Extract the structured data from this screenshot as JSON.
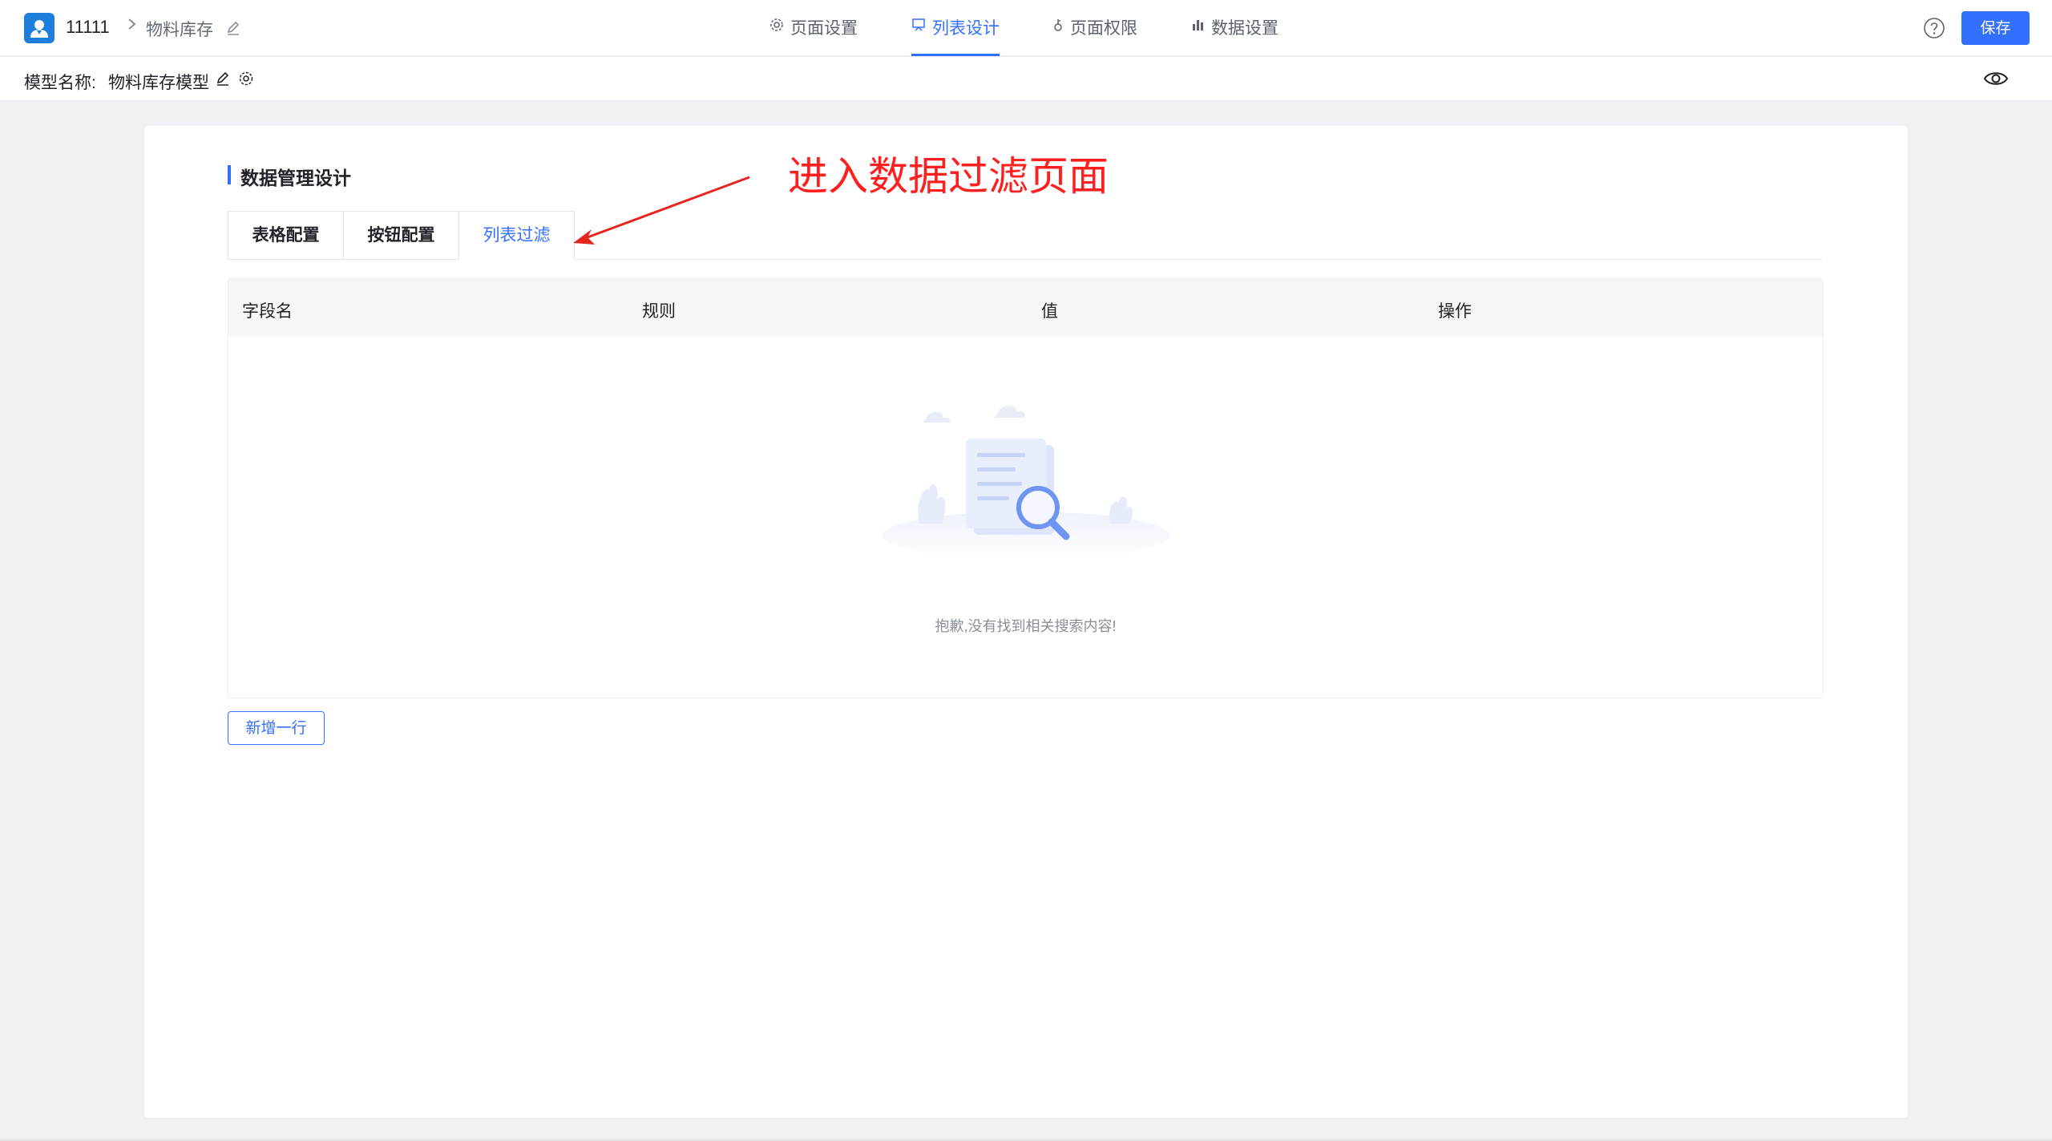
{
  "header": {
    "app_name": "11111",
    "breadcrumb_sep": ">",
    "page_name": "物料库存",
    "nav_tabs": [
      {
        "label": "页面设置",
        "icon": "gear-icon"
      },
      {
        "label": "列表设计",
        "icon": "list-design-icon",
        "active": true
      },
      {
        "label": "页面权限",
        "icon": "key-icon"
      },
      {
        "label": "数据设置",
        "icon": "bar-chart-icon"
      }
    ],
    "save_label": "保存"
  },
  "model_bar": {
    "label": "模型名称:",
    "value": "物料库存模型"
  },
  "main": {
    "section_title": "数据管理设计",
    "tabs": [
      {
        "label": "表格配置"
      },
      {
        "label": "按钮配置"
      },
      {
        "label": "列表过滤",
        "active": true
      }
    ],
    "table": {
      "columns": [
        "字段名",
        "规则",
        "值",
        "操作"
      ],
      "rows": [],
      "empty_text": "抱歉,没有找到相关搜索内容!"
    },
    "add_row_label": "新增一行"
  },
  "annotation": {
    "text": "进入数据过滤页面",
    "color": "#ff1f1f"
  },
  "colors": {
    "accent": "#3370ff",
    "background": "#f0f1f4"
  }
}
